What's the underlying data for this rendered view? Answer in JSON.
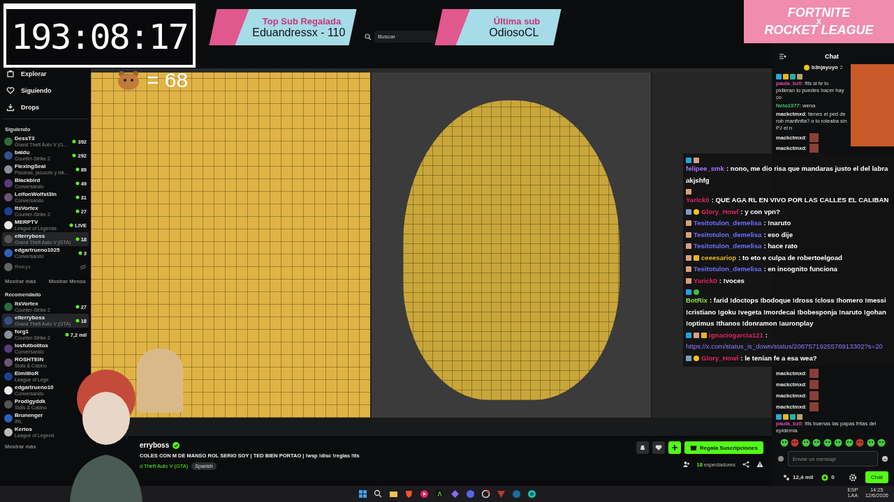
{
  "timer": "193:08:17",
  "alerts": [
    {
      "label": "Top Sub Regalada",
      "value": "Eduandressx - 110"
    },
    {
      "label": "Última sub",
      "value": "OdiosoCL"
    }
  ],
  "promo": {
    "line_1": "FORTNITE",
    "line_2": "X",
    "line_3": "ROCKET LEAGUE"
  },
  "emote_counter": "= 68",
  "header": {
    "search": {
      "placeholder": "Buscar"
    }
  },
  "sidebar": {
    "nav": [
      {
        "label": "Explorar"
      },
      {
        "label": "Siguiendo"
      },
      {
        "label": "Drops"
      }
    ],
    "following_title": "Siguiendo",
    "following": [
      {
        "name": "DessT3",
        "category": "Grand Theft Auto V (G...",
        "viewers": "392",
        "selected": false,
        "disabled": false
      },
      {
        "name": "baldu",
        "category": "Counter-Strike 2",
        "viewers": "292",
        "selected": false,
        "disabled": false
      },
      {
        "name": "FlexingSeal",
        "category": "Piscinas, jacuzzis y bik...",
        "viewers": "89",
        "selected": false,
        "disabled": false
      },
      {
        "name": "Blackbird",
        "category": "Conversando",
        "viewers": "49",
        "selected": false,
        "disabled": false
      },
      {
        "name": "LeifonWolfst3in",
        "category": "Conversando",
        "viewers": "31",
        "selected": false,
        "disabled": false
      },
      {
        "name": "ItsVortex",
        "category": "Counter-Strike 2",
        "viewers": "27",
        "selected": false,
        "disabled": false
      },
      {
        "name": "MERPTV",
        "category": "League of Legends",
        "viewers": "LIVE",
        "selected": false,
        "disabled": false
      },
      {
        "name": "elterryboss",
        "category": "Grand Theft Auto V (GTA)",
        "viewers": "18",
        "selected": true,
        "disabled": false
      },
      {
        "name": "edgartrueno1025",
        "category": "Conversando",
        "viewers": "3",
        "selected": false,
        "disabled": false
      },
      {
        "name": "Rakyz",
        "selected": false,
        "disabled": true
      }
    ],
    "show_more": "Mostrar más",
    "show_less": "Mostrar Menos",
    "recommended_title": "Recomendado",
    "recommended": [
      {
        "name": "ItsVortex",
        "category": "Counter-Strike 2",
        "viewers": "27",
        "selected": false,
        "disabled": false
      },
      {
        "name": "elterryboss",
        "category": "Grand Theft Auto V (GTA)",
        "viewers": "18",
        "selected": true,
        "disabled": false
      },
      {
        "name": "forg1",
        "category": "Counter-Strike 2",
        "viewers": "7,2 mil",
        "selected": false,
        "disabled": false
      },
      {
        "name": "losfutbolitos",
        "category": "Conversando",
        "selected": false,
        "disabled": false
      },
      {
        "name": "ROSHTEIN",
        "category": "Slots & Casino",
        "selected": false,
        "disabled": false
      },
      {
        "name": "ElmiilloR",
        "category": "League of Lege",
        "selected": false,
        "disabled": false
      },
      {
        "name": "edgartrueno10",
        "category": "Conversando",
        "selected": false,
        "disabled": false
      },
      {
        "name": "Prodigyddk",
        "category": "Slots & Casino",
        "selected": false,
        "disabled": false
      },
      {
        "name": "Brunenger",
        "category": "IRL",
        "selected": false,
        "disabled": false
      },
      {
        "name": "Kerios",
        "category": "League of Legend",
        "selected": false,
        "disabled": false
      }
    ],
    "show_more_2": "Mostrar más"
  },
  "stream": {
    "channel": "erryboss",
    "verified": true,
    "title": "COLES CON M DE MANSO ROL SERIO SOY | TED BIEN PORTAO | !wsp !disc !reglas !tts",
    "category": "d Theft Auto V (GTA)",
    "tags": [
      "Spanish"
    ],
    "viewers": "18",
    "viewers_label": "espectadores",
    "gift_button": "Regala Suscripciones"
  },
  "chat": {
    "title": "Chat",
    "pinned": {
      "name": "b3njayuyo",
      "count": "2"
    },
    "messages_top": [
      {
        "badges": [
          {
            "kind": "tier"
          },
          {
            "kind": "crown"
          },
          {
            "kind": "og"
          },
          {
            "kind": "hat"
          }
        ],
        "user": "paula_bz0",
        "color": "#d94fb0",
        "text": ": !tts si te lo pidieran lo puedes hacer hay co"
      },
      {
        "user": "Neto1977",
        "color": "#3ec46d",
        "text": ": wena"
      },
      {
        "user": "mackctmxd",
        "color": "#e8e8e8",
        "text": ": tienes el ped de rob manfinfla? o lo roleaba sin PJ el n"
      },
      {
        "user": "mackctmxd",
        "color": "#e8e8e8",
        "text": ":",
        "emote": true
      },
      {
        "user": "mackctmxd",
        "color": "#e8e8e8",
        "text": ":",
        "emote": true
      }
    ],
    "messages_bottom": [
      {
        "user": "mackctmxd",
        "color": "#e8e8e8",
        "text": ":",
        "emote": true
      },
      {
        "user": "mackctmxd",
        "color": "#e8e8e8",
        "text": ":",
        "emote": true
      },
      {
        "user": "mackctmxd",
        "color": "#e8e8e8",
        "text": ":",
        "emote": true
      },
      {
        "user": "mackctmxd",
        "color": "#e8e8e8",
        "text": ":",
        "emote": true
      },
      {
        "badges": [
          {
            "kind": "tier"
          },
          {
            "kind": "crown"
          },
          {
            "kind": "og"
          },
          {
            "kind": "hat"
          }
        ],
        "user": "paula_bz0",
        "color": "#d94fb0",
        "text": ": !tts buenas las papas fritas del epidemia"
      }
    ],
    "input": {
      "placeholder": "Enviar un mensaje"
    },
    "followers": "12,4 mil",
    "points": "0",
    "send_button": "Chat"
  },
  "overlay_chat": [
    {
      "badges": [
        {
          "kind": "mod"
        },
        {
          "kind": "sub"
        }
      ],
      "user": "felipee_smk",
      "color": "#a970ff",
      "text": ": nono, me dio risa que mandaras justo el del labra akjshfg"
    },
    {
      "badges": [
        {
          "kind": "sub"
        }
      ],
      "user": "Yarick0",
      "color": "#e0245e",
      "text": ": QUE AGA RL EN VIVO POR LAS CALLES EL CALIBAN"
    },
    {
      "badges": [
        {
          "kind": "pin"
        },
        {
          "kind": "gift"
        }
      ],
      "user": "Glory_Howl",
      "color": "#e0245e",
      "text": ": y con vpn?"
    },
    {
      "badges": [
        {
          "kind": "sub"
        }
      ],
      "user": "Tesitotulon_demelisa",
      "color": "#6f6fff",
      "text": ": !naruto"
    },
    {
      "badges": [
        {
          "kind": "sub"
        }
      ],
      "user": "Tesitotulon_demelisa",
      "color": "#6f6fff",
      "text": ": eso dije"
    },
    {
      "badges": [
        {
          "kind": "sub"
        }
      ],
      "user": "Tesitotulon_demelisa",
      "color": "#6f6fff",
      "text": ": hace rato"
    },
    {
      "badges": [
        {
          "kind": "sub"
        },
        {
          "kind": "crown"
        }
      ],
      "user": "ceeesariop",
      "color": "#e6b422",
      "text": ": to eto e culpa de robertoelgoad"
    },
    {
      "badges": [
        {
          "kind": "sub"
        }
      ],
      "user": "Tesitotulon_demelisa",
      "color": "#6f6fff",
      "text": ": en incognito funciona"
    },
    {
      "badges": [
        {
          "kind": "sub"
        }
      ],
      "user": "Yarick0",
      "color": "#e0245e",
      "text": ": !voces"
    },
    {
      "badges": [
        {
          "kind": "mod"
        },
        {
          "kind": "verified"
        }
      ],
      "user": "BotRix",
      "color": "#8fe13c",
      "text": ": farid !doctops !bodoque !dross !closs !homero !messi !cristiano !goku !vegeta !mordecai !bobesponja !naruto !gohan !optimus !thanos !donramon !auronplay"
    },
    {
      "badges": [
        {
          "kind": "mod"
        },
        {
          "kind": "sub"
        },
        {
          "kind": "crown"
        }
      ],
      "user": "ignaciogarcia121",
      "color": "#e0245e",
      "text": ":",
      "link": "https://x.com/status_is_down/status/2087571925576913302?s=20"
    },
    {
      "badges": [
        {
          "kind": "pin"
        },
        {
          "kind": "gift"
        }
      ],
      "user": "Glory_Howl",
      "color": "#e0245e",
      "text": ": le tenían fe a esa wea?"
    }
  ],
  "taskbar": {
    "language": "ESP",
    "layout": "LAA",
    "time": "14:25",
    "date": "12/6/2026"
  }
}
